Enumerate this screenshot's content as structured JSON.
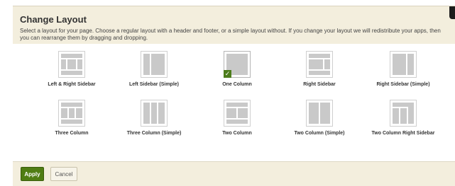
{
  "dialog": {
    "title": "Change Layout",
    "description": "Select a layout for your page. Choose a regular layout with a header and footer, or a simple layout without. If you change your layout we will redistribute your apps, then you can rearrange them by dragging and dropping."
  },
  "layouts": [
    {
      "label": "Left & Right Sidebar",
      "selected": false
    },
    {
      "label": "Left Sidebar (Simple)",
      "selected": false
    },
    {
      "label": "One Column",
      "selected": true
    },
    {
      "label": "Right Sidebar",
      "selected": false
    },
    {
      "label": "Right Sidebar (Simple)",
      "selected": false
    },
    {
      "label": "Three Column",
      "selected": false
    },
    {
      "label": "Three Column (Simple)",
      "selected": false
    },
    {
      "label": "Two Column",
      "selected": false
    },
    {
      "label": "Two Column (Simple)",
      "selected": false
    },
    {
      "label": "Two Column Right Sidebar",
      "selected": false
    }
  ],
  "selected_mark": "✓",
  "buttons": {
    "apply": "Apply",
    "cancel": "Cancel"
  },
  "colors": {
    "accent": "#4f7d13",
    "header_bg": "#f3eedd",
    "thumb_fill": "#c9c9c9"
  }
}
